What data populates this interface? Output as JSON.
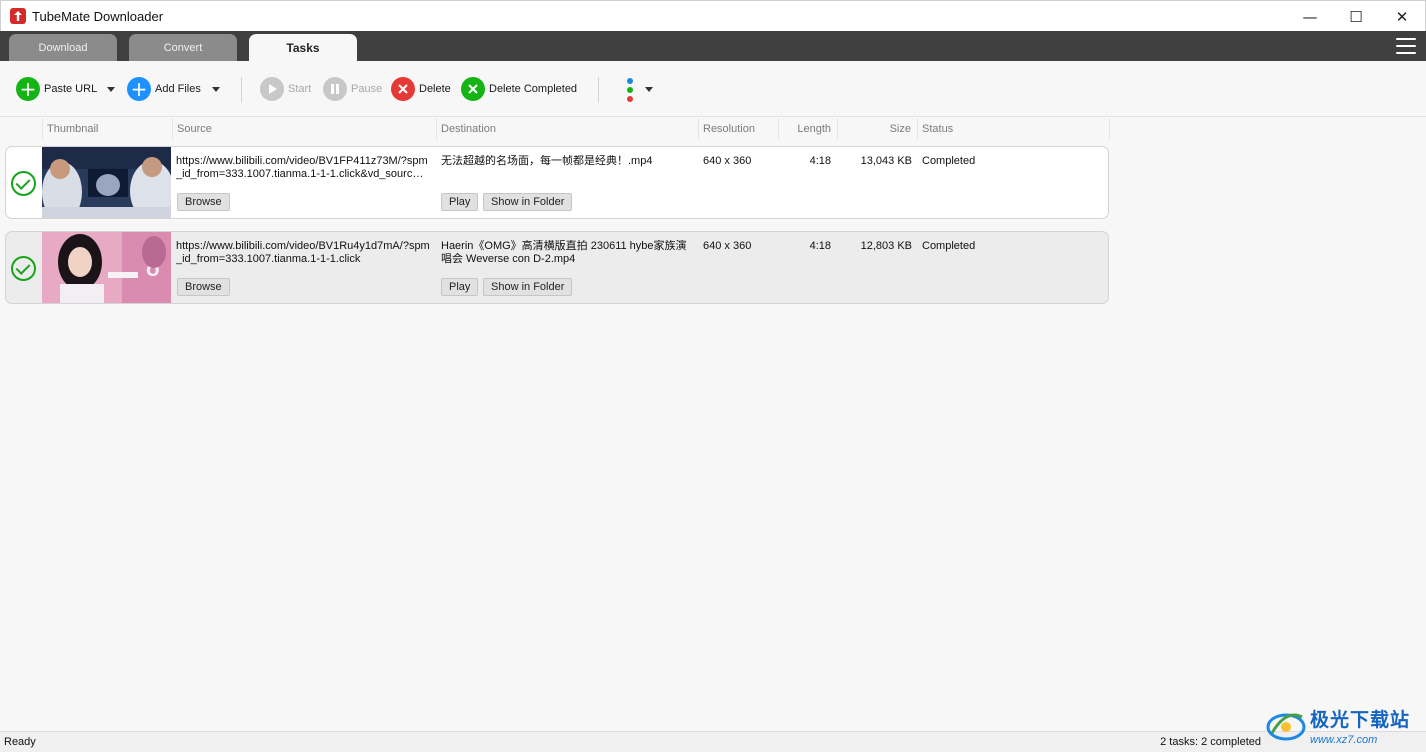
{
  "window": {
    "title": "TubeMate Downloader",
    "controls": {
      "minimize": "—",
      "maximize": "☐",
      "close": "✕"
    }
  },
  "tabs": [
    {
      "label": "Download",
      "active": false
    },
    {
      "label": "Convert",
      "active": false
    },
    {
      "label": "Tasks",
      "active": true
    }
  ],
  "toolbar": {
    "paste_url": "Paste URL",
    "add_files": "Add Files",
    "start": "Start",
    "pause": "Pause",
    "delete": "Delete",
    "delete_completed": "Delete Completed"
  },
  "columns": {
    "thumbnail": "Thumbnail",
    "source": "Source",
    "destination": "Destination",
    "resolution": "Resolution",
    "length": "Length",
    "size": "Size",
    "status": "Status"
  },
  "tasks": [
    {
      "source": "https://www.bilibili.com/video/BV1FP411z73M/?spm_id_from=333.1007.tianma.1-1-1.click&vd_sourc…",
      "destination": "无法超越的名场面，每一帧都是经典！.mp4",
      "resolution": "640 x 360",
      "length": "4:18",
      "size": "13,043 KB",
      "status": "Completed",
      "browse": "Browse",
      "play": "Play",
      "show_in_folder": "Show in Folder"
    },
    {
      "source": "https://www.bilibili.com/video/BV1Ru4y1d7mA/?spm_id_from=333.1007.tianma.1-1-1.click",
      "destination": "Haerin《OMG》高清横版直拍 230611 hybe家族演唱会 Weverse con D-2.mp4",
      "resolution": "640 x 360",
      "length": "4:18",
      "size": "12,803 KB",
      "status": "Completed",
      "browse": "Browse",
      "play": "Play",
      "show_in_folder": "Show in Folder"
    }
  ],
  "statusbar": {
    "left": "Ready",
    "right": "2 tasks: 2 completed"
  },
  "watermark": {
    "name": "极光下载站",
    "url": "www.xz7.com"
  },
  "colors": {
    "accent_green": "#17a31a",
    "add_blue": "#1e90ff",
    "delete_red": "#e53935",
    "tabbar": "#3f3f3f"
  }
}
